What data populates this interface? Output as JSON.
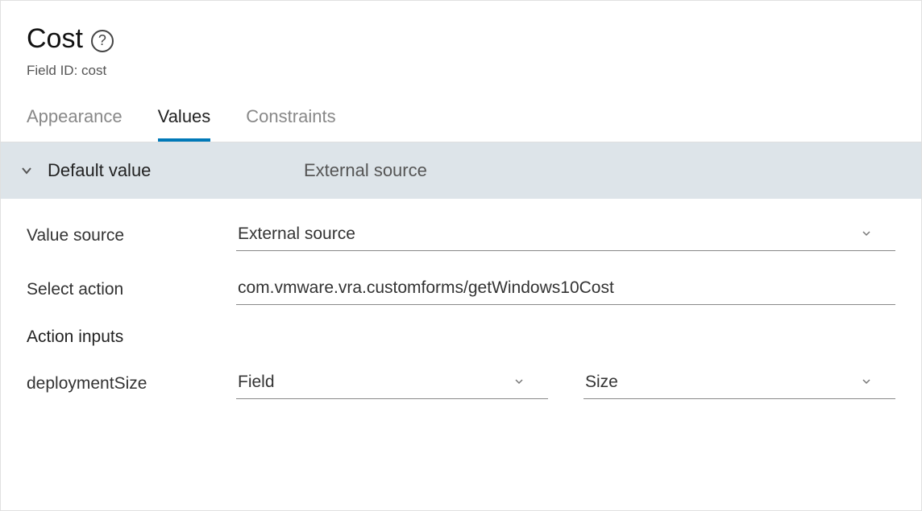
{
  "header": {
    "title": "Cost",
    "field_id_label": "Field ID: cost"
  },
  "tabs": {
    "appearance": "Appearance",
    "values": "Values",
    "constraints": "Constraints"
  },
  "section": {
    "label": "Default value",
    "value": "External source"
  },
  "form": {
    "value_source_label": "Value source",
    "value_source_value": "External source",
    "select_action_label": "Select action",
    "select_action_value": "com.vmware.vra.customforms/getWindows10Cost",
    "action_inputs_heading": "Action inputs",
    "deployment_size_label": "deploymentSize",
    "deployment_size_type": "Field",
    "deployment_size_value": "Size"
  }
}
